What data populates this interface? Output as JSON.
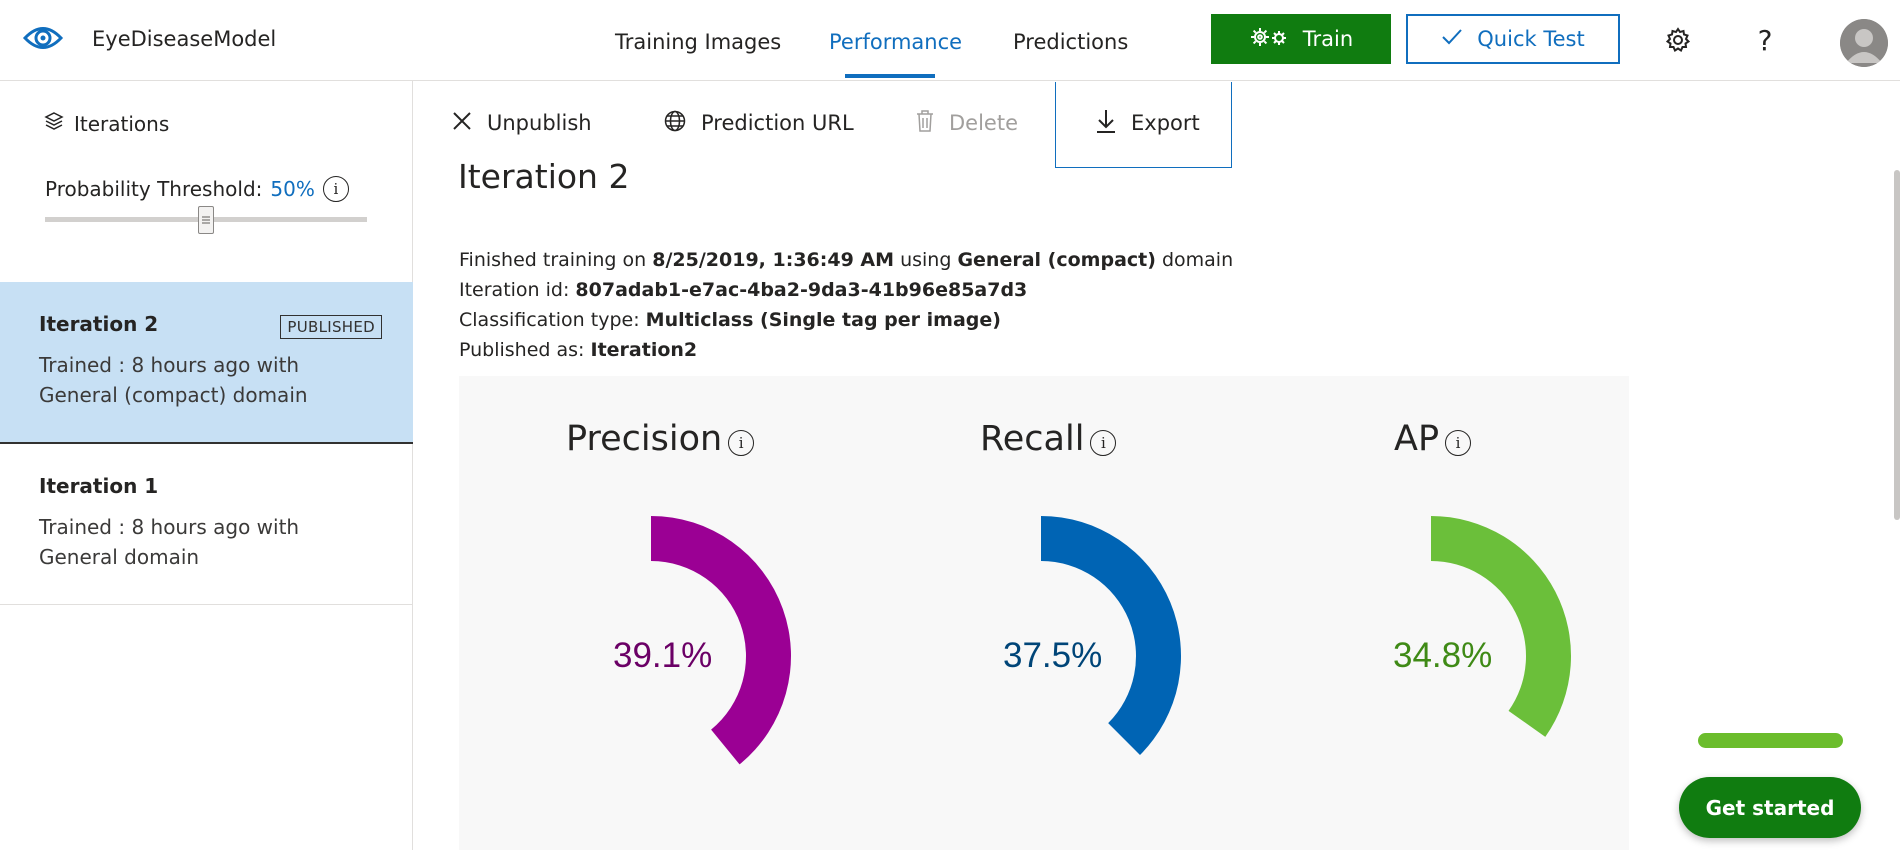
{
  "app": {
    "name": "EyeDiseaseModel"
  },
  "nav": {
    "tabs": [
      {
        "label": "Training Images",
        "active": false
      },
      {
        "label": "Performance",
        "active": true
      },
      {
        "label": "Predictions",
        "active": false
      }
    ],
    "train_label": "Train",
    "quick_test_label": "Quick Test",
    "help_glyph": "?",
    "icons": [
      "eye-logo-icon",
      "gears-icon",
      "checkmark-icon",
      "settings-gear-icon",
      "help-icon",
      "user-avatar-icon"
    ]
  },
  "sidebar": {
    "iterations_label": "Iterations",
    "threshold_label": "Probability Threshold:",
    "threshold_value": "50%",
    "threshold_fraction": 0.5,
    "items": [
      {
        "name": "Iteration 2",
        "badge": "PUBLISHED",
        "desc": "Trained : 8 hours ago with General (compact) domain",
        "selected": true
      },
      {
        "name": "Iteration 1",
        "badge": "",
        "desc": "Trained : 8 hours ago with General domain",
        "selected": false
      }
    ]
  },
  "toolbar": {
    "unpublish": "Unpublish",
    "prediction_url": "Prediction URL",
    "delete": "Delete",
    "export": "Export"
  },
  "main": {
    "title": "Iteration 2",
    "details": {
      "finished_prefix": "Finished training on",
      "finished_date": "8/25/2019, 1:36:49 AM",
      "using_word": "using",
      "domain_name": "General (compact)",
      "domain_word": "domain",
      "iter_id_label": "Iteration id:",
      "iter_id": "807adab1-e7ac-4ba2-9da3-41b96e85a7d3",
      "class_type_label": "Classification type:",
      "class_type": "Multiclass (Single tag per image)",
      "published_label": "Published as:",
      "published_name": "Iteration2"
    },
    "metrics": [
      {
        "title": "Precision",
        "value_text": "39.1%",
        "value": 0.391,
        "color": "#9b0094",
        "text_color": "#6b0066"
      },
      {
        "title": "Recall",
        "value_text": "37.5%",
        "value": 0.375,
        "color": "#0064b4",
        "text_color": "#004578"
      },
      {
        "title": "AP",
        "value_text": "34.8%",
        "value": 0.348,
        "color": "#6bbf3a",
        "text_color": "#3f8a16"
      }
    ]
  },
  "get_started_label": "Get started",
  "colors": {
    "accent": "#106ebe",
    "primary_green": "#107c10",
    "selected_bg": "#c7e0f4"
  }
}
